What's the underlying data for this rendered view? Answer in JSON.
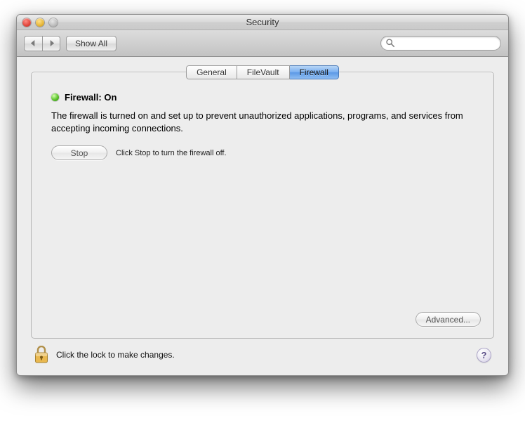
{
  "window": {
    "title": "Security"
  },
  "toolbar": {
    "show_all_label": "Show All",
    "search_placeholder": ""
  },
  "tabs": [
    {
      "label": "General",
      "active": false
    },
    {
      "label": "FileVault",
      "active": false
    },
    {
      "label": "Firewall",
      "active": true
    }
  ],
  "status": {
    "indicator": "on",
    "text": "Firewall: On"
  },
  "description": "The firewall is turned on and set up to prevent unauthorized applications, programs, and services from accepting incoming connections.",
  "stop": {
    "button_label": "Stop",
    "hint": "Click Stop to turn the firewall off."
  },
  "advanced_label": "Advanced...",
  "footer": {
    "lock_text": "Click the lock to make changes.",
    "help_label": "?"
  },
  "icons": {
    "back": "back-triangle-icon",
    "forward": "forward-triangle-icon",
    "search": "search-icon",
    "lock": "lock-icon"
  }
}
